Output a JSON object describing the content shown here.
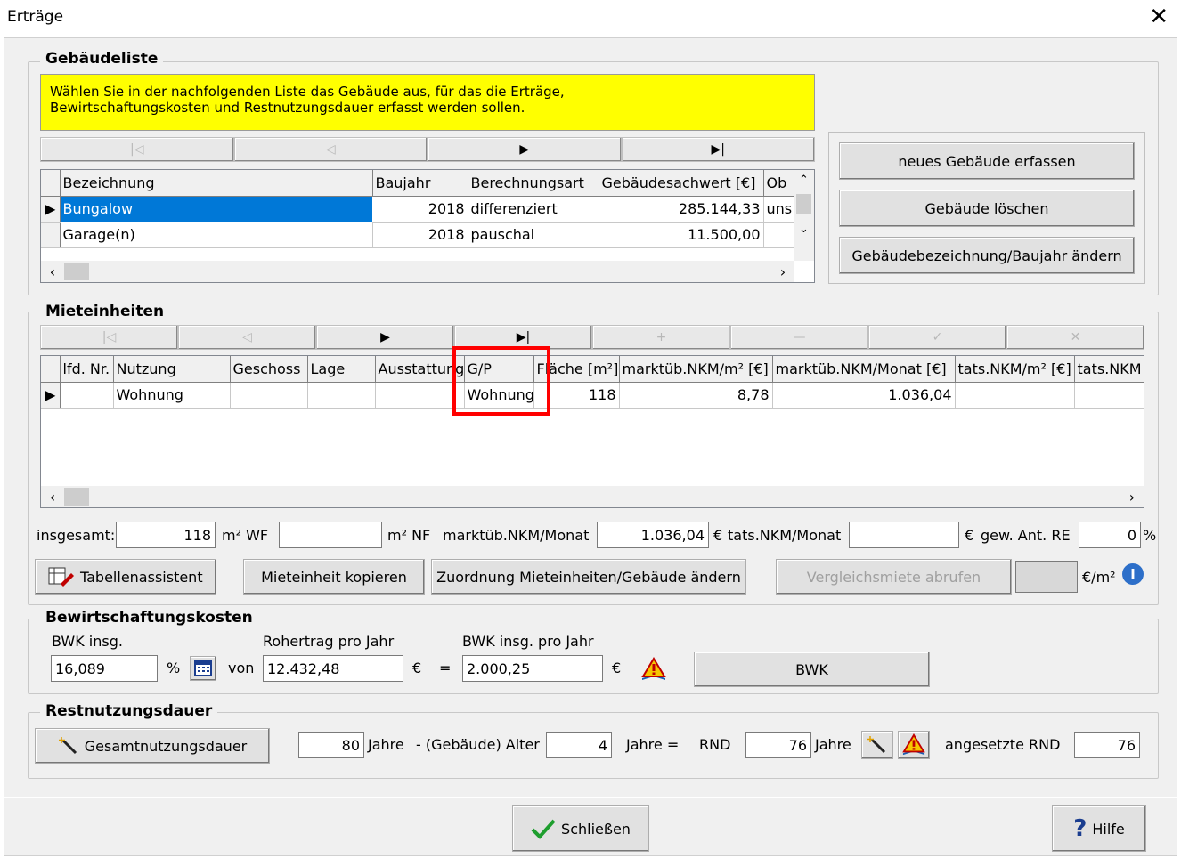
{
  "window": {
    "title": "Erträge",
    "close_glyph": "✕"
  },
  "gebaeudeliste": {
    "title": "Gebäudeliste",
    "hint_line1": "Wählen Sie in der nachfolgenden Liste das Gebäude aus, für das die Erträge,",
    "hint_line2": "Bewirtschaftungskosten und Restnutzungsdauer erfasst werden sollen.",
    "columns": [
      "Bezeichnung",
      "Baujahr",
      "Berechnungsart",
      "Gebäudesachwert [€]",
      "Ob"
    ],
    "rows": [
      {
        "bezeichnung": "Bungalow",
        "baujahr": "2018",
        "berechnungsart": "differenziert",
        "sachwert": "285.144,33",
        "ob": "uns",
        "selected": true
      },
      {
        "bezeichnung": "Garage(n)",
        "baujahr": "2018",
        "berechnungsart": "pauschal",
        "sachwert": "11.500,00",
        "ob": "",
        "selected": false
      }
    ],
    "buttons": {
      "new": "neues Gebäude erfassen",
      "delete": "Gebäude löschen",
      "rename": "Gebäudebezeichnung/Baujahr ändern"
    }
  },
  "mieteinheiten": {
    "title": "Mieteinheiten",
    "columns": [
      "lfd. Nr.",
      "Nutzung",
      "Geschoss",
      "Lage",
      "Ausstattung",
      "G/P",
      "Fläche [m²]",
      "marktüb.NKM/m² [€]",
      "marktüb.NKM/Monat [€]",
      "tats.NKM/m² [€]",
      "tats.NKM"
    ],
    "rows": [
      {
        "lfd": "",
        "nutzung": "Wohnung",
        "geschoss": "",
        "lage": "",
        "ausstattung": "",
        "gp": "Wohnung",
        "flaeche": "118",
        "nkm_m2": "8,78",
        "nkm_monat": "1.036,04",
        "tats_m2": "",
        "tats": ""
      }
    ],
    "summary": {
      "insgesamt_label": "insgesamt:",
      "wf_value": "118",
      "wf_unit": "m² WF",
      "nf_value": "",
      "nf_unit": "m² NF",
      "nkm_label": "marktüb.NKM/Monat",
      "nkm_value": "1.036,04",
      "nkm_unit": "€",
      "tats_label": "tats.NKM/Monat",
      "tats_value": "",
      "tats_unit": "€",
      "gew_label": "gew. Ant. RE",
      "gew_value": "0",
      "gew_unit": "%"
    },
    "buttons": {
      "tabellenassistent": "Tabellenassistent",
      "kopieren": "Mieteinheit kopieren",
      "zuordnung": "Zuordnung Mieteinheiten/Gebäude ändern",
      "vergleichsmiete": "Vergleichsmiete abrufen",
      "vergleich_unit": "€/m²"
    }
  },
  "bwk": {
    "title": "Bewirtschaftungskosten",
    "bwk_label": "BWK insg.",
    "bwk_value": "16,089",
    "percent": "%",
    "von": "von",
    "rohertrag_label": "Rohertrag pro Jahr",
    "rohertrag_value": "12.432,48",
    "euro1": "€",
    "equals": "=",
    "bwk_jahr_label": "BWK insg. pro Jahr",
    "bwk_jahr_value": "2.000,25",
    "euro2": "€",
    "button": "BWK"
  },
  "rnd": {
    "title": "Restnutzungsdauer",
    "gnd_button": "Gesamtnutzungsdauer",
    "gnd_value": "80",
    "jahre1": "Jahre",
    "minus_alter": "-  (Gebäude) Alter",
    "alter_value": "4",
    "jahre_eq": "Jahre  =",
    "rnd_label": "RND",
    "rnd_value": "76",
    "jahre2": "Jahre",
    "angesetzt_label": "angesetzte RND",
    "angesetzt_value": "76"
  },
  "footer": {
    "schliessen": "Schließen",
    "hilfe": "Hilfe"
  },
  "colors": {
    "highlight_box": "#ff0000",
    "selection": "#0078d7",
    "hint": "#ffff00"
  }
}
